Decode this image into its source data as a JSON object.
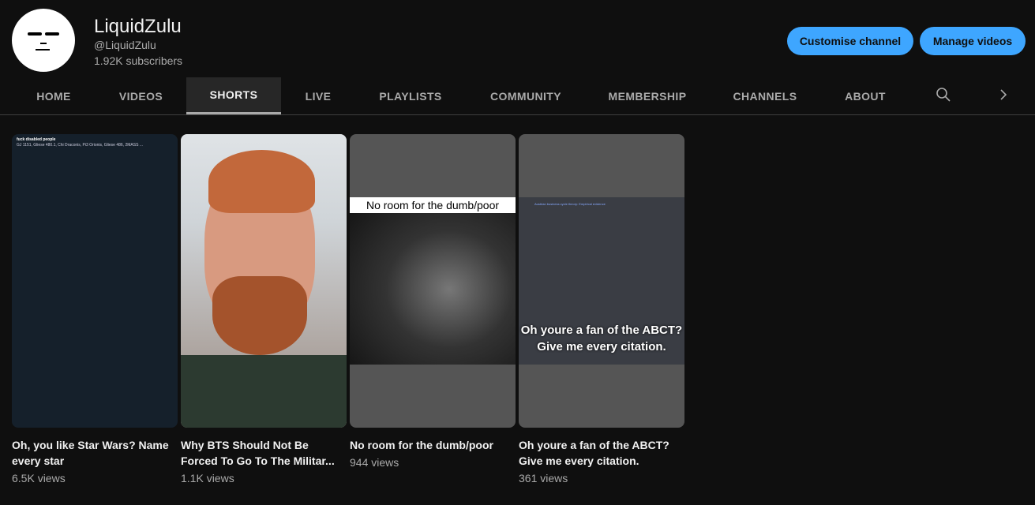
{
  "channel": {
    "name": "LiquidZulu",
    "handle": "@LiquidZulu",
    "subscribers": "1.92K subscribers"
  },
  "buttons": {
    "customise": "Customise channel",
    "manage": "Manage videos"
  },
  "colors": {
    "accent": "#3ea6ff",
    "background": "#0f0f0f"
  },
  "tabs": [
    "HOME",
    "VIDEOS",
    "SHORTS",
    "LIVE",
    "PLAYLISTS",
    "COMMUNITY",
    "MEMBERSHIP",
    "CHANNELS",
    "ABOUT"
  ],
  "active_tab": "SHORTS",
  "icons": {
    "search": "search-icon",
    "next": "chevron-right-icon"
  },
  "shorts": [
    {
      "title": "Oh, you like Star Wars? Name every star",
      "views": "6.5K views",
      "tweet_author": "fuck disabled people",
      "tweet_text": "GJ 1151, Gliese 480.1, Chi Draconis, Pi3 Orionis, Gliese 486, 2MASS ..."
    },
    {
      "title": "Why BTS Should Not Be Forced To Go To The Militar...",
      "views": "1.1K views"
    },
    {
      "title": "No room for the dumb/poor",
      "views": "944 views",
      "overlay": "No room for the dumb/poor"
    },
    {
      "title": "Oh youre a fan of the ABCT? Give me every citation.",
      "views": "361 views",
      "overlay": "Oh youre a fan of the ABCT? Give me every citation.",
      "doc_text": "Austrian business cycle theory: Empirical evidence"
    }
  ]
}
